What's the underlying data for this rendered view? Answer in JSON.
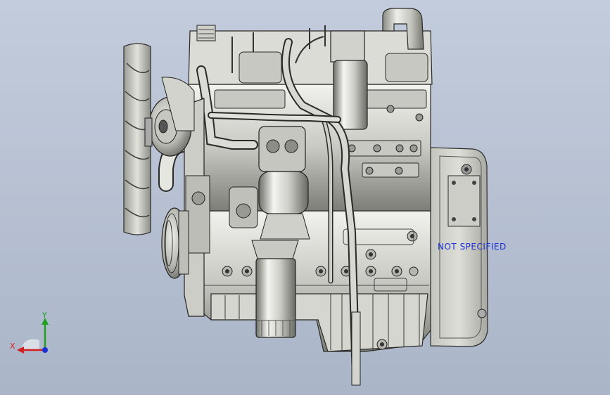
{
  "viewport": {
    "background_top": "#c3ccdc",
    "background_bottom": "#aab5c8",
    "model_name": "engine-assembly"
  },
  "annotation": {
    "text": "NOT SPECIFIED",
    "color": "#1b2fd6"
  },
  "triad": {
    "x_label": "X",
    "y_label": "Y",
    "x_color": "#d42020",
    "y_color": "#20a020",
    "z_color": "#1a2fd6"
  }
}
